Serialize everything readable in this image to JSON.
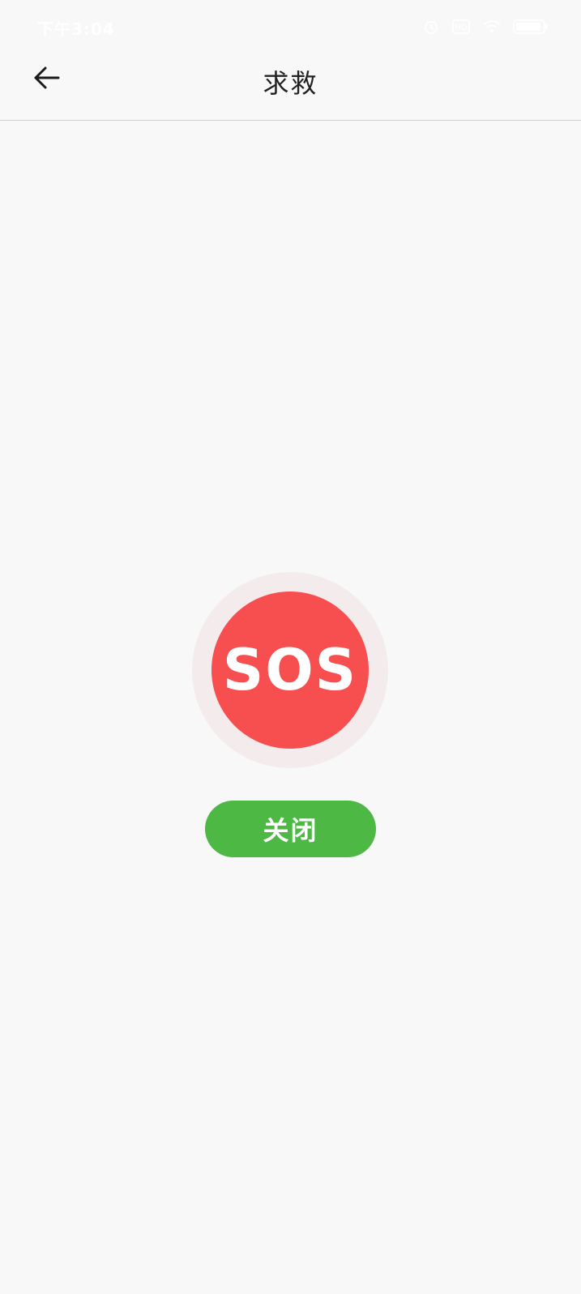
{
  "status_bar": {
    "time": "下午3:04",
    "icons": [
      "alarm-icon",
      "sim-icon",
      "wifi-icon",
      "battery-icon"
    ]
  },
  "header": {
    "title": "求救",
    "back_icon": "arrow-left-icon"
  },
  "sos": {
    "label": "SOS",
    "color": "#f74f4f",
    "ring_color": "#f4ecec"
  },
  "close_button": {
    "label": "关闭",
    "color": "#4db844"
  }
}
